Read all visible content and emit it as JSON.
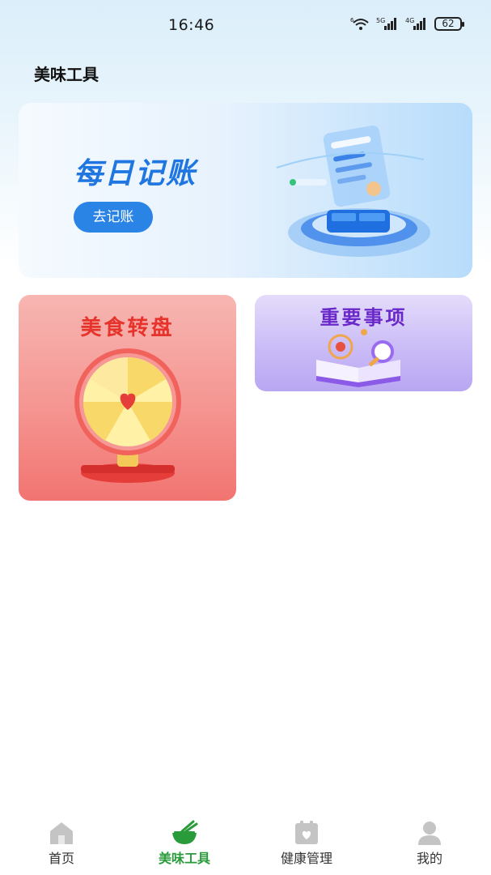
{
  "status_bar": {
    "time": "16:46",
    "battery": "62",
    "wifi_label": "6",
    "signal1_label": "5G",
    "signal2_label": "4G"
  },
  "page": {
    "title": "美味工具"
  },
  "banner": {
    "title": "每日记账",
    "button_label": "去记账"
  },
  "cards": {
    "food_wheel_title": "美食转盘",
    "todo_title": "重要事项"
  },
  "bottom_nav": {
    "items": [
      {
        "label": "首页",
        "icon": "home-icon"
      },
      {
        "label": "美味工具",
        "icon": "bowl-icon"
      },
      {
        "label": "健康管理",
        "icon": "health-calendar-icon"
      },
      {
        "label": "我的",
        "icon": "profile-icon"
      }
    ],
    "active_index": 1
  },
  "colors": {
    "accent_green": "#2a9b3a",
    "banner_blue": "#1f76e0",
    "food_red": "#e6332b",
    "todo_purple": "#6a28c9"
  }
}
